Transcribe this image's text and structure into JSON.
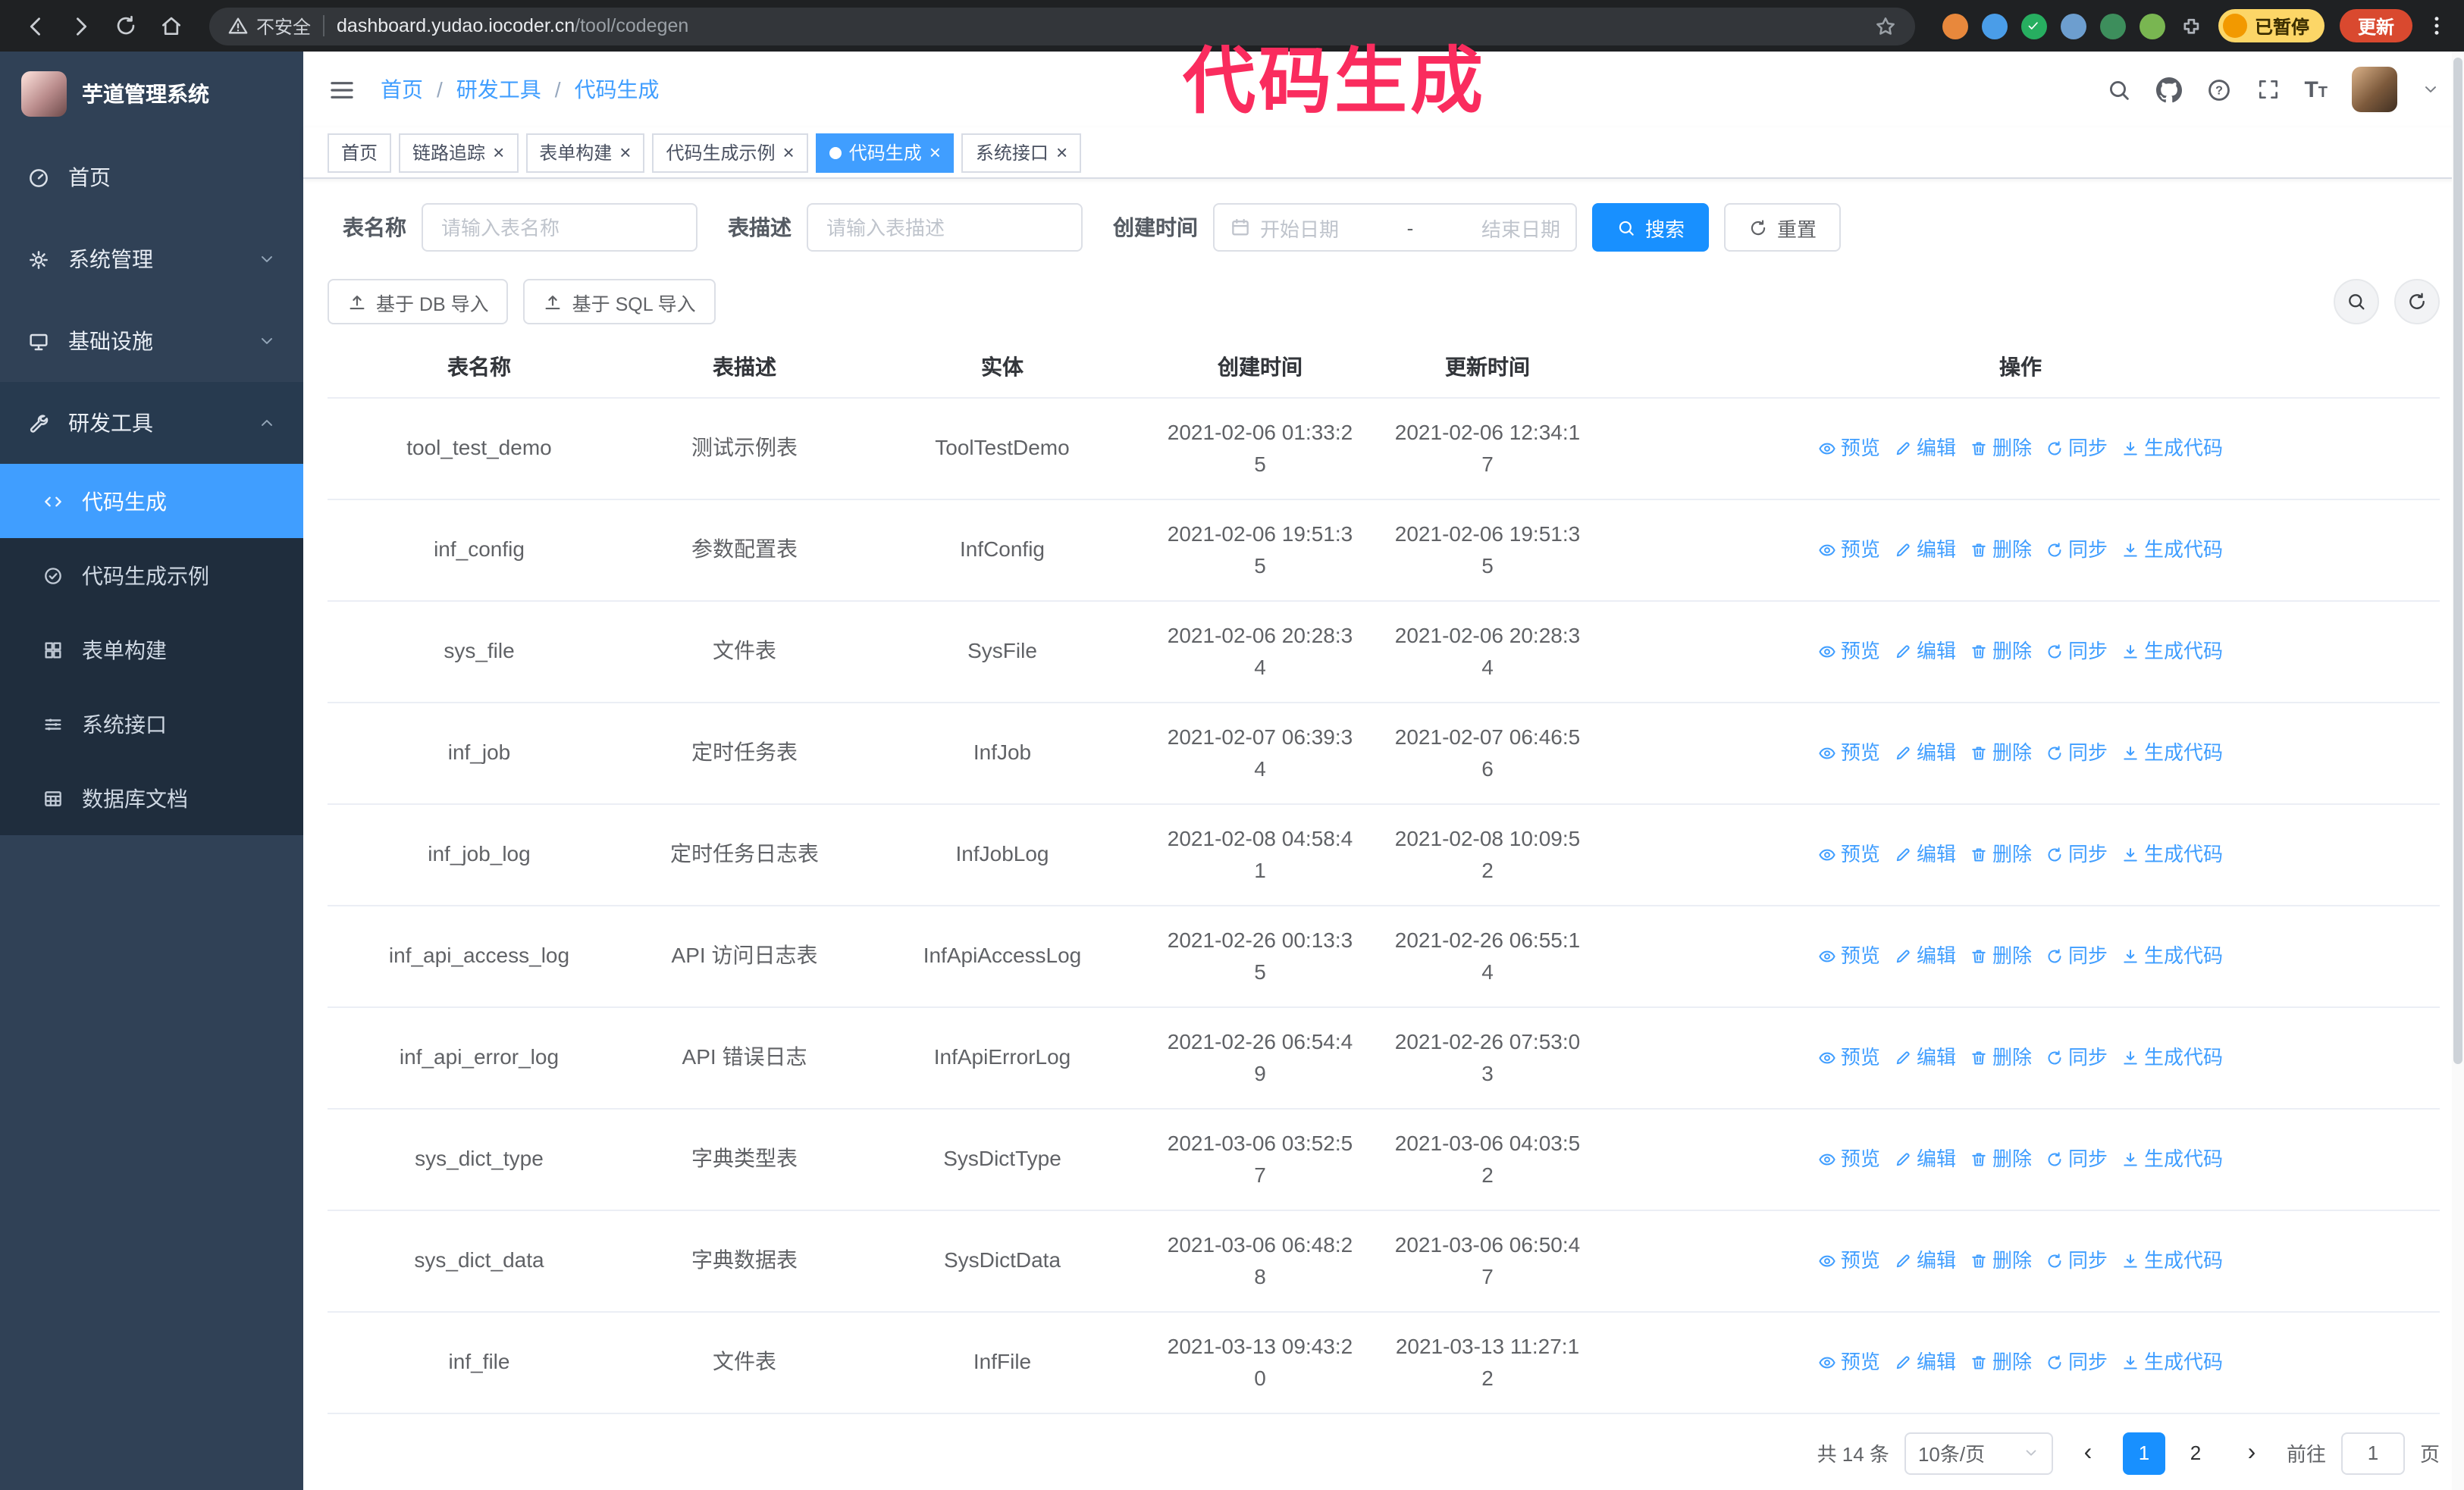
{
  "annotation": {
    "text": "代码生成"
  },
  "colors": {
    "primary": "#1890ff",
    "link": "#409eff",
    "sidebar-bg": "#304156",
    "submenu-bg": "#1f2d3d",
    "menu-active-bg": "#409eff",
    "tag-active-bg": "#409eff",
    "annotation": "#fa2c5e",
    "update-chip-bg": "#d9492f",
    "paused-chip-bg": "#fcd667"
  },
  "browser": {
    "security_label": "不安全",
    "url_host": "dashboard.yudao.iocoder.cn",
    "url_path": "/tool/codegen",
    "paused_chip_label": "已暂停",
    "update_button_label": "更新"
  },
  "sidebar": {
    "logo_title": "芋道管理系统",
    "items": [
      {
        "label": "首页",
        "icon": "dashboard-icon"
      },
      {
        "label": "系统管理",
        "icon": "gear-icon",
        "chevron": "down"
      },
      {
        "label": "基础设施",
        "icon": "infra-icon",
        "chevron": "down"
      },
      {
        "label": "研发工具",
        "icon": "tools-icon",
        "chevron": "up",
        "expanded": true
      }
    ],
    "subitems": [
      {
        "label": "代码生成",
        "icon": "code-icon",
        "active": true
      },
      {
        "label": "代码生成示例",
        "icon": "example-icon"
      },
      {
        "label": "表单构建",
        "icon": "form-icon"
      },
      {
        "label": "系统接口",
        "icon": "api-icon"
      },
      {
        "label": "数据库文档",
        "icon": "database-icon"
      }
    ]
  },
  "header": {
    "breadcrumb": [
      "首页",
      "研发工具",
      "代码生成"
    ]
  },
  "tabs": [
    {
      "label": "首页",
      "closable": false
    },
    {
      "label": "链路追踪",
      "closable": true
    },
    {
      "label": "表单构建",
      "closable": true
    },
    {
      "label": "代码生成示例",
      "closable": true
    },
    {
      "label": "代码生成",
      "closable": true,
      "active": true
    },
    {
      "label": "系统接口",
      "closable": true
    }
  ],
  "filters": {
    "table_name_label": "表名称",
    "table_name_placeholder": "请输入表名称",
    "table_desc_label": "表描述",
    "table_desc_placeholder": "请输入表描述",
    "create_time_label": "创建时间",
    "date_start_placeholder": "开始日期",
    "date_separator": "-",
    "date_end_placeholder": "结束日期",
    "search_button_label": "搜索",
    "reset_button_label": "重置"
  },
  "toolbar": {
    "import_db_label": "基于 DB 导入",
    "import_sql_label": "基于 SQL 导入"
  },
  "table": {
    "columns": [
      "表名称",
      "表描述",
      "实体",
      "创建时间",
      "更新时间",
      "操作"
    ],
    "action_labels": [
      "预览",
      "编辑",
      "删除",
      "同步",
      "生成代码"
    ],
    "rows": [
      {
        "name": "tool_test_demo",
        "description": "测试示例表",
        "entity": "ToolTestDemo",
        "create_time": "2021-02-06 01:33:25",
        "update_time": "2021-02-06 12:34:17"
      },
      {
        "name": "inf_config",
        "description": "参数配置表",
        "entity": "InfConfig",
        "create_time": "2021-02-06 19:51:35",
        "update_time": "2021-02-06 19:51:35"
      },
      {
        "name": "sys_file",
        "description": "文件表",
        "entity": "SysFile",
        "create_time": "2021-02-06 20:28:34",
        "update_time": "2021-02-06 20:28:34"
      },
      {
        "name": "inf_job",
        "description": "定时任务表",
        "entity": "InfJob",
        "create_time": "2021-02-07 06:39:34",
        "update_time": "2021-02-07 06:46:56"
      },
      {
        "name": "inf_job_log",
        "description": "定时任务日志表",
        "entity": "InfJobLog",
        "create_time": "2021-02-08 04:58:41",
        "update_time": "2021-02-08 10:09:52"
      },
      {
        "name": "inf_api_access_log",
        "description": "API 访问日志表",
        "entity": "InfApiAccessLog",
        "create_time": "2021-02-26 00:13:35",
        "update_time": "2021-02-26 06:55:14"
      },
      {
        "name": "inf_api_error_log",
        "description": "API 错误日志",
        "entity": "InfApiErrorLog",
        "create_time": "2021-02-26 06:54:49",
        "update_time": "2021-02-26 07:53:03"
      },
      {
        "name": "sys_dict_type",
        "description": "字典类型表",
        "entity": "SysDictType",
        "create_time": "2021-03-06 03:52:57",
        "update_time": "2021-03-06 04:03:52"
      },
      {
        "name": "sys_dict_data",
        "description": "字典数据表",
        "entity": "SysDictData",
        "create_time": "2021-03-06 06:48:28",
        "update_time": "2021-03-06 06:50:47"
      },
      {
        "name": "inf_file",
        "description": "文件表",
        "entity": "InfFile",
        "create_time": "2021-03-13 09:43:20",
        "update_time": "2021-03-13 11:27:12"
      }
    ]
  },
  "pagination": {
    "total_label": "共 14 条",
    "page_size_label": "10条/页",
    "pages": [
      "1",
      "2"
    ],
    "active_page": "1",
    "goto_label": "前往",
    "goto_value": "1",
    "goto_unit_label": "页"
  }
}
